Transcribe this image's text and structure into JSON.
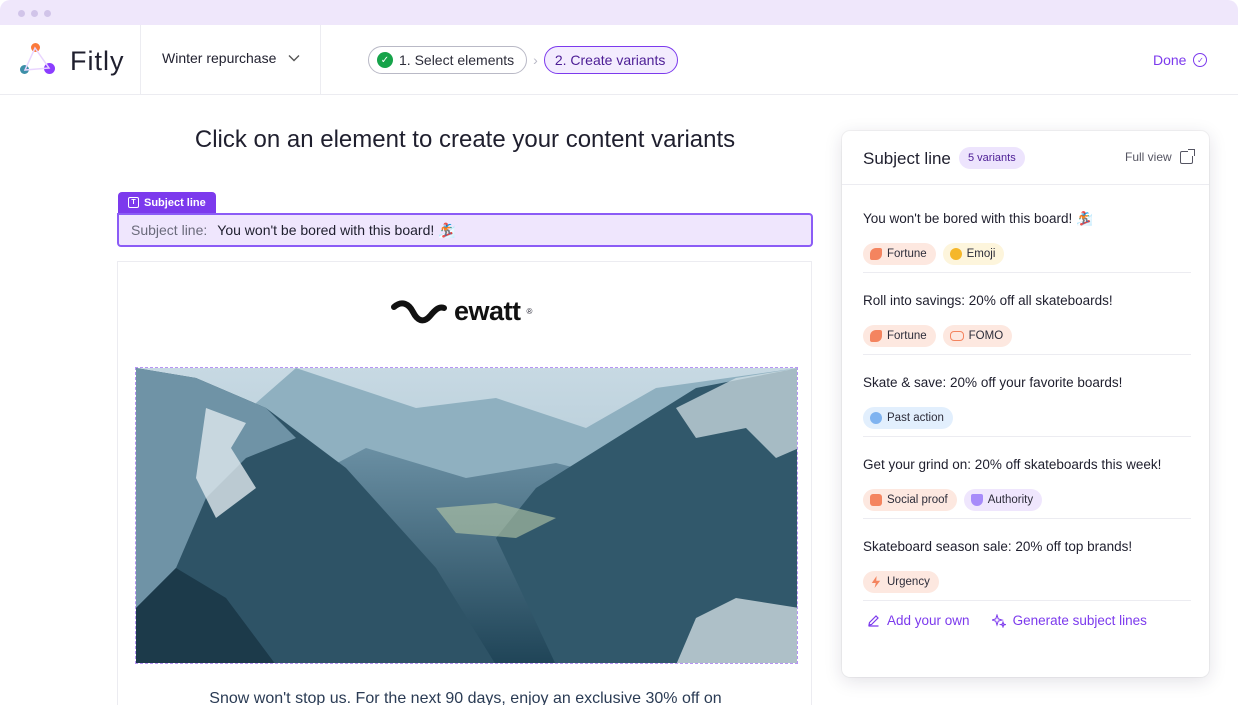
{
  "app": {
    "name": "Fitly"
  },
  "header": {
    "campaign": "Winter repurchase",
    "steps": [
      {
        "label": "1. Select elements",
        "state": "done"
      },
      {
        "label": "2. Create variants",
        "state": "active"
      }
    ],
    "done_label": "Done"
  },
  "main": {
    "heading": "Click on an element to create your content variants",
    "subject_tag": "Subject line",
    "subject_label": "Subject line:",
    "subject_value": "You won't be bored with this board! 🏂",
    "email": {
      "brand": "ewatt",
      "brand_mark": "®",
      "body_text": "Snow won't stop us. For the next 90 days, enjoy an exclusive 30% off on"
    }
  },
  "panel": {
    "title": "Subject line",
    "count": "5 variants",
    "full_view": "Full view",
    "variants": [
      {
        "text": "You won't be bored with this board! 🏂",
        "tags": [
          "Fortune",
          "Emoji"
        ]
      },
      {
        "text": "Roll into savings: 20% off all skateboards!",
        "tags": [
          "Fortune",
          "FOMO"
        ]
      },
      {
        "text": "Skate & save: 20% off your favorite boards!",
        "tags": [
          "Past action"
        ]
      },
      {
        "text": "Get your grind on: 20% off skateboards this week!",
        "tags": [
          "Social proof",
          "Authority"
        ]
      },
      {
        "text": "Skateboard season sale: 20% off top brands!",
        "tags": [
          "Urgency"
        ]
      }
    ],
    "add_own": "Add your own",
    "generate": "Generate subject lines"
  },
  "colors": {
    "accent": "#7c3aed",
    "success": "#16a34a",
    "subject_bg": "#efe6fd"
  }
}
